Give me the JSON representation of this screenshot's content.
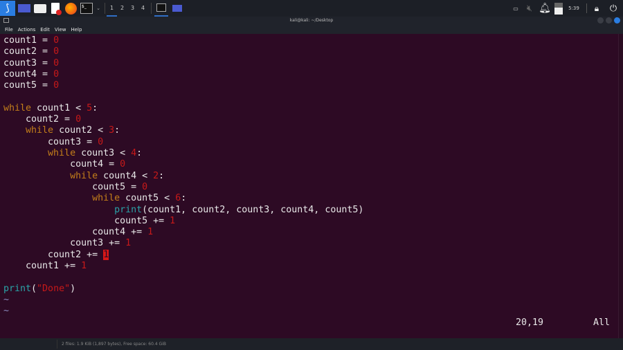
{
  "taskbar": {
    "workspaces": [
      "1",
      "2",
      "3",
      "4"
    ],
    "active_workspace": "1",
    "clock": "5:39",
    "icons": [
      "kali-menu-icon",
      "desktop-icon",
      "folder-icon",
      "text-editor-icon",
      "firefox-icon",
      "terminal-icon"
    ]
  },
  "window": {
    "title": "kali@kali: ~/Desktop"
  },
  "menu": [
    "File",
    "Actions",
    "Edit",
    "View",
    "Help"
  ],
  "editor": {
    "lines": [
      [
        [
          "v",
          "count1 = "
        ],
        [
          "num",
          "0"
        ]
      ],
      [
        [
          "v",
          "count2 = "
        ],
        [
          "num",
          "0"
        ]
      ],
      [
        [
          "v",
          "count3 = "
        ],
        [
          "num",
          "0"
        ]
      ],
      [
        [
          "v",
          "count4 = "
        ],
        [
          "num",
          "0"
        ]
      ],
      [
        [
          "v",
          "count5 = "
        ],
        [
          "num",
          "0"
        ]
      ],
      [],
      [
        [
          "kw",
          "while"
        ],
        [
          "v",
          " count1 < "
        ],
        [
          "num",
          "5"
        ],
        [
          "v",
          ":"
        ]
      ],
      [
        [
          "v",
          "    count2 = "
        ],
        [
          "num",
          "0"
        ]
      ],
      [
        [
          "kw",
          "    while"
        ],
        [
          "v",
          " count2 < "
        ],
        [
          "num",
          "3"
        ],
        [
          "v",
          ":"
        ]
      ],
      [
        [
          "v",
          "        count3 = "
        ],
        [
          "num",
          "0"
        ]
      ],
      [
        [
          "kw",
          "        while"
        ],
        [
          "v",
          " count3 < "
        ],
        [
          "num",
          "4"
        ],
        [
          "v",
          ":"
        ]
      ],
      [
        [
          "v",
          "            count4 = "
        ],
        [
          "num",
          "0"
        ]
      ],
      [
        [
          "kw",
          "            while"
        ],
        [
          "v",
          " count4 < "
        ],
        [
          "num",
          "2"
        ],
        [
          "v",
          ":"
        ]
      ],
      [
        [
          "v",
          "                count5 = "
        ],
        [
          "num",
          "0"
        ]
      ],
      [
        [
          "kw",
          "                while"
        ],
        [
          "v",
          " count5 < "
        ],
        [
          "num",
          "6"
        ],
        [
          "v",
          ":"
        ]
      ],
      [
        [
          "fn",
          "                    print"
        ],
        [
          "v",
          "(count1, count2, count3, count4, count5)"
        ]
      ],
      [
        [
          "v",
          "                    count5 += "
        ],
        [
          "num",
          "1"
        ]
      ],
      [
        [
          "v",
          "                count4 += "
        ],
        [
          "num",
          "1"
        ]
      ],
      [
        [
          "v",
          "            count3 += "
        ],
        [
          "num",
          "1"
        ]
      ],
      [
        [
          "v",
          "        count2 += "
        ],
        [
          "cur",
          "1"
        ]
      ],
      [
        [
          "v",
          "    count1 += "
        ],
        [
          "num",
          "1"
        ]
      ],
      [],
      [
        [
          "fn",
          "print"
        ],
        [
          "v",
          "("
        ],
        [
          "str",
          "\"Done\""
        ],
        [
          "v",
          ")"
        ]
      ],
      [
        [
          "tilde",
          "~"
        ]
      ],
      [
        [
          "tilde",
          "~"
        ]
      ]
    ],
    "position": "20,19",
    "scroll": "All"
  },
  "statusbar": {
    "text": "2 files: 1.9 KiB (1,897 bytes), Free space: 60.4 GiB"
  }
}
